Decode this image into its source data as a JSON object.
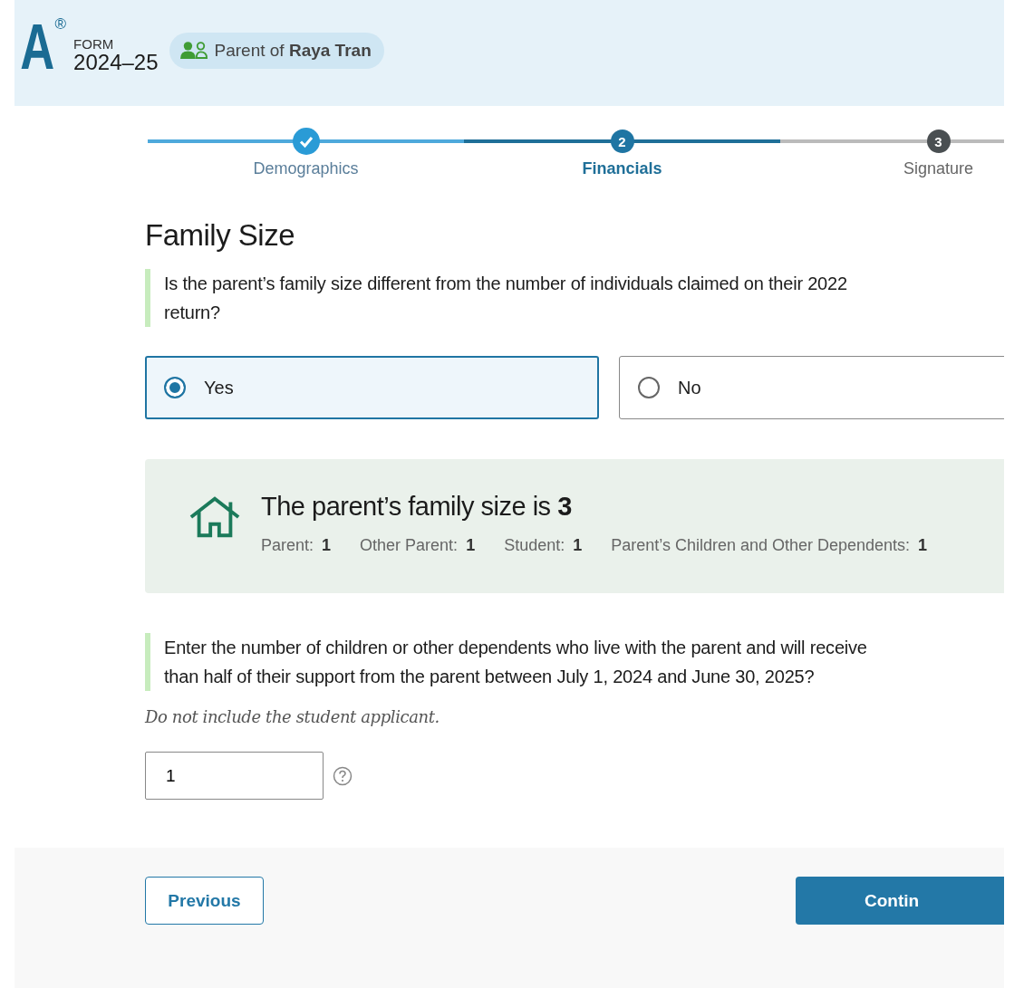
{
  "header": {
    "logo": "A",
    "registered": "®",
    "form_label": "FORM",
    "form_year": "2024–25",
    "role_badge": "Parent of **Raya Tran**"
  },
  "steps": [
    {
      "label": "Demographics",
      "completed": true,
      "current": false
    },
    {
      "label": "Financials",
      "completed": false,
      "current": true,
      "number": "2"
    },
    {
      "label": "Signature",
      "completed": false,
      "current": false,
      "number": "3"
    }
  ],
  "page_title": "Family Size",
  "question": {
    "lines": [
      "Is the parent’s family size different from the number of individuals claimed on their 2022",
      "return?"
    ]
  },
  "options": [
    {
      "label": "Yes",
      "selected": true
    },
    {
      "label": "No",
      "selected": false
    }
  ],
  "summary": {
    "headline": "The parent’s family size is **3**",
    "items": [
      {
        "label": "Parent:",
        "value": "1"
      },
      {
        "label": "Other Parent:",
        "value": "1"
      },
      {
        "label": "Student:",
        "value": "1"
      },
      {
        "label": "Parent’s Children and Other Dependents:",
        "value": "1"
      }
    ]
  },
  "question2": {
    "lines": [
      "Enter the number of children or other dependents who live with the parent and will receive",
      "than half of their support from the parent between July 1, 2024 and June 30, 2025?"
    ],
    "hint": "Do not include the student applicant.",
    "value": "1"
  },
  "buttons": {
    "previous": "Previous",
    "next": "Contin"
  }
}
